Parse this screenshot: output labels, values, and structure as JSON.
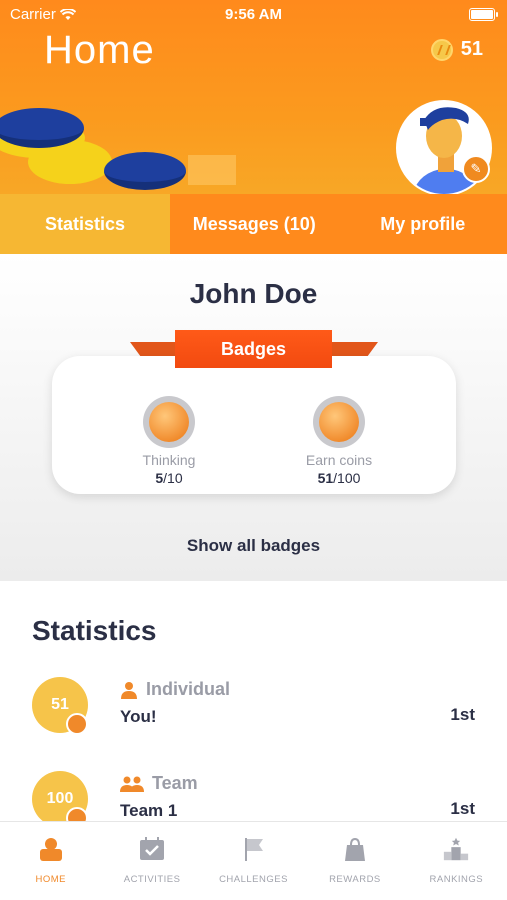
{
  "status_bar": {
    "carrier": "Carrier",
    "time": "9:56 AM"
  },
  "header": {
    "title": "Home",
    "coins": "51"
  },
  "tabs": [
    {
      "label": "Statistics",
      "active": true
    },
    {
      "label": "Messages (10)",
      "active": false
    },
    {
      "label": "My profile",
      "active": false
    }
  ],
  "profile": {
    "name": "John Doe",
    "badges_title": "Badges",
    "badges": [
      {
        "name": "Thinking",
        "earned": "5",
        "total": "/10"
      },
      {
        "name": "Earn coins",
        "earned": "51",
        "total": "/100"
      }
    ],
    "show_all": "Show all badges"
  },
  "statistics": {
    "title": "Statistics",
    "rows": [
      {
        "score": "51",
        "category": "Individual",
        "name": "You!",
        "rank": "1st"
      },
      {
        "score": "100",
        "category": "Team",
        "name": "Team 1",
        "rank": "1st"
      }
    ]
  },
  "bottom_nav": [
    {
      "label": "HOME",
      "icon": "home-icon",
      "active": true
    },
    {
      "label": "ACTIVITIES",
      "icon": "calendar-check-icon",
      "active": false
    },
    {
      "label": "CHALLENGES",
      "icon": "flag-icon",
      "active": false
    },
    {
      "label": "REWARDS",
      "icon": "shopping-bag-icon",
      "active": false
    },
    {
      "label": "RANKINGS",
      "icon": "podium-icon",
      "active": false
    }
  ],
  "colors": {
    "primary": "#ff8a1c",
    "accent": "#f6b733",
    "ribbon": "#f24a10",
    "text": "#2b2f45"
  }
}
